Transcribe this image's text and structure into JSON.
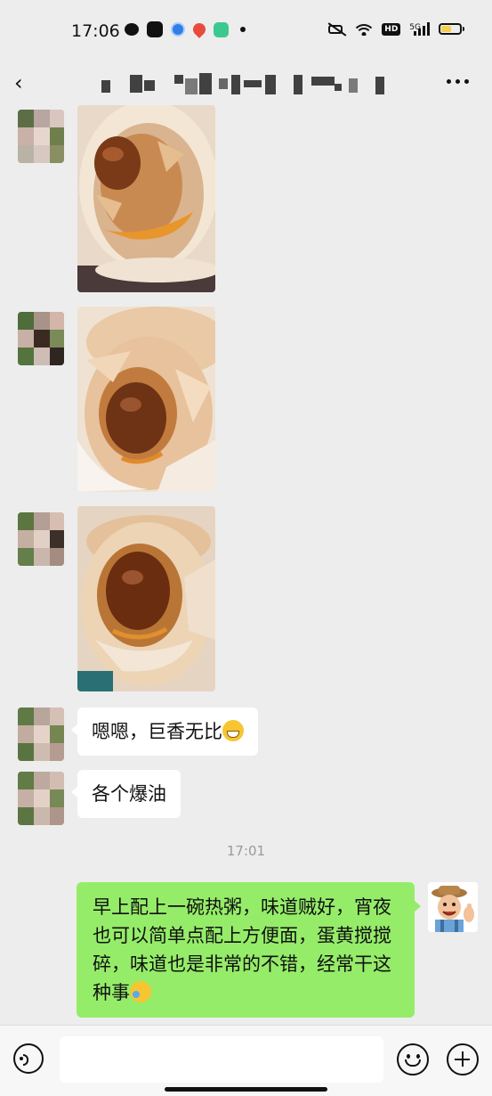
{
  "status_bar": {
    "time": "17:06",
    "left_icons": [
      "wechat-icon",
      "capcut-icon",
      "browser-icon",
      "map-icon",
      "app-icon",
      "notification-dot-icon"
    ],
    "right_icons": [
      "mute-icon",
      "wifi-icon",
      "hd-badge",
      "5g-signal-icon",
      "battery-icon"
    ],
    "hd_label": "HD",
    "network_label": "5G",
    "battery_level": 0.55
  },
  "nav": {
    "back_icon": "chevron-left-icon",
    "more_icon": "more-dots-icon"
  },
  "messages": [
    {
      "type": "image",
      "from": "contact",
      "content": "salted egg yolk photo 1"
    },
    {
      "type": "image",
      "from": "contact",
      "content": "salted egg yolk photo 2"
    },
    {
      "type": "image",
      "from": "contact",
      "content": "salted egg yolk photo 3"
    },
    {
      "type": "text",
      "from": "contact",
      "text": "嗯嗯，巨香无比",
      "emoji": "grin-emoji"
    },
    {
      "type": "text",
      "from": "contact",
      "text": "各个爆油"
    },
    {
      "type": "time",
      "text": "17:01"
    },
    {
      "type": "text",
      "from": "me",
      "text": "早上配上一碗热粥，味道贼好，宵夜也可以简单点配上方便面，蛋黄搅搅碎，味道也是非常的不错，经常干这种事",
      "emoji": "laughing-tears-emoji"
    }
  ],
  "input_bar": {
    "voice_icon": "voice-icon",
    "input_value": "",
    "emoji_icon": "emoji-icon",
    "plus_icon": "plus-icon"
  },
  "colors": {
    "background": "#ededed",
    "my_bubble": "#95ec69",
    "their_bubble": "#ffffff",
    "timestamp": "#9a9a9a"
  }
}
